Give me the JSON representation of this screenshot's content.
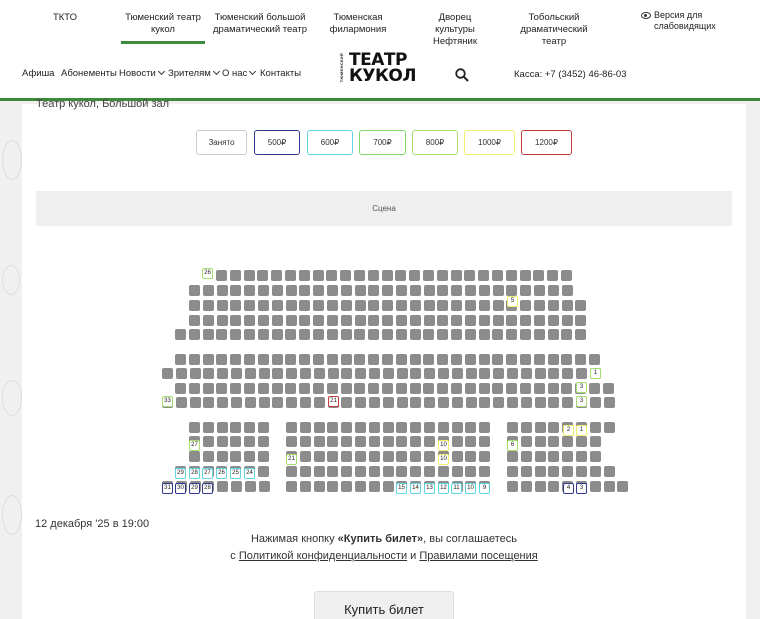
{
  "top_nav": {
    "items": [
      {
        "label": "ТКТО"
      },
      {
        "label": "Тюменский театр кукол"
      },
      {
        "label": "Тюменский большой драматический театр"
      },
      {
        "label": "Тюменская филармония"
      },
      {
        "label": "Дворец культуры Нефтяник"
      },
      {
        "label": "Тобольский драматический театр"
      }
    ],
    "active_index": 1,
    "accessibility": {
      "label": "Версия для слабовидящих",
      "icon": "eye-icon"
    }
  },
  "main_nav": {
    "items": [
      {
        "label": "Афиша",
        "dropdown": false
      },
      {
        "label": "Абонементы",
        "dropdown": false
      },
      {
        "label": "Новости",
        "dropdown": true
      },
      {
        "label": "Зрителям",
        "dropdown": true
      },
      {
        "label": "О нас",
        "dropdown": true
      },
      {
        "label": "Контакты",
        "dropdown": false
      }
    ],
    "logo": {
      "side": "ТЮМЕНСКИЙ",
      "line1": "ТЕАТР",
      "line2": "КУКОЛ"
    },
    "search_icon": "search-icon",
    "kassa": "Касса: +7 (3452) 46-86-03",
    "accent_color": "#3d8a3a"
  },
  "content": {
    "hall_name": "Театр кукол, Большой зал",
    "legend": [
      {
        "label": "Занято",
        "color": "#cccccc"
      },
      {
        "label": "500₽",
        "color": "#2f3a8f"
      },
      {
        "label": "600₽",
        "color": "#5fd7e0"
      },
      {
        "label": "700₽",
        "color": "#7fd66b"
      },
      {
        "label": "800₽",
        "color": "#a6df6e"
      },
      {
        "label": "1000₽",
        "color": "#f2ef6e"
      },
      {
        "label": "1200₽",
        "color": "#c23a3a"
      }
    ],
    "stage_label": "Сцена",
    "date": "12 декабря '25 в 19:00",
    "notice": {
      "line1_pre": "Нажимая кнопку ",
      "line1_bold": "«Купить билет»",
      "line1_post": ", вы соглашаетесь",
      "line2_pre": "с ",
      "line2_link1": "Политикой конфиденциальности",
      "line2_mid": " и ",
      "line2_link2": "Правилами посещения"
    },
    "buy_button": "Купить билет",
    "available_seats": [
      {
        "label": "26",
        "price": "800₽"
      },
      {
        "label": "5",
        "price": "1000₽"
      },
      {
        "label": "1",
        "price": "800₽"
      },
      {
        "label": "3",
        "price": "800₽"
      },
      {
        "label": "33",
        "price": "800₽"
      },
      {
        "label": "21",
        "price": "1200₽"
      },
      {
        "label": "3",
        "price": "800₽"
      },
      {
        "label": "27",
        "price": "800₽"
      },
      {
        "label": "10",
        "price": "1000₽"
      },
      {
        "label": "6",
        "price": "800₽"
      },
      {
        "label": "2",
        "price": "1000₽"
      },
      {
        "label": "1",
        "price": "1000₽"
      },
      {
        "label": "21",
        "price": "800₽"
      },
      {
        "label": "10",
        "price": "1000₽"
      },
      {
        "label": "29",
        "price": "600₽"
      },
      {
        "label": "28",
        "price": "600₽"
      },
      {
        "label": "27",
        "price": "600₽"
      },
      {
        "label": "26",
        "price": "600₽"
      },
      {
        "label": "25",
        "price": "600₽"
      },
      {
        "label": "24",
        "price": "600₽"
      },
      {
        "label": "31",
        "price": "500₽"
      },
      {
        "label": "30",
        "price": "500₽"
      },
      {
        "label": "29",
        "price": "500₽"
      },
      {
        "label": "28",
        "price": "500₽"
      },
      {
        "label": "15",
        "price": "600₽"
      },
      {
        "label": "14",
        "price": "600₽"
      },
      {
        "label": "13",
        "price": "600₽"
      },
      {
        "label": "12",
        "price": "600₽"
      },
      {
        "label": "11",
        "price": "600₽"
      },
      {
        "label": "10",
        "price": "600₽"
      },
      {
        "label": "9",
        "price": "600₽"
      },
      {
        "label": "4",
        "price": "500₽"
      },
      {
        "label": "3",
        "price": "500₽"
      }
    ]
  }
}
